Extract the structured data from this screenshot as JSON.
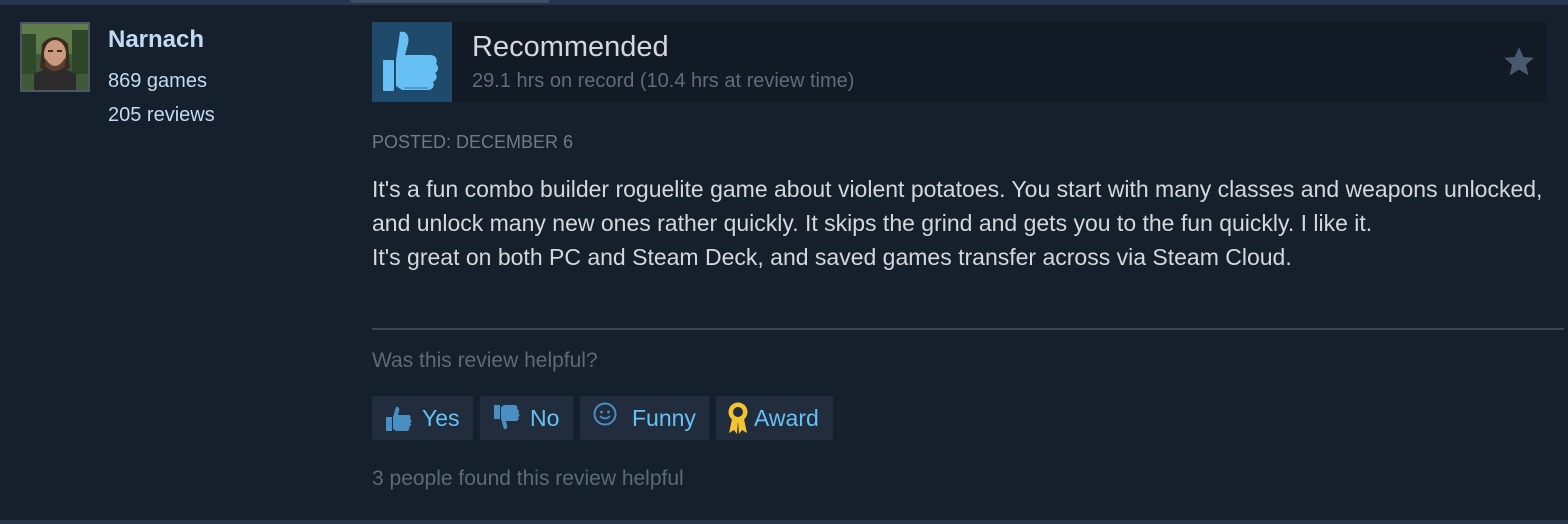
{
  "author": {
    "name": "Narnach",
    "games": "869 games",
    "reviews": "205 reviews"
  },
  "review": {
    "verdict": "Recommended",
    "hours": "29.1 hrs on record (10.4 hrs at review time)",
    "posted": "POSTED: DECEMBER 6",
    "paragraphs": [
      "It's a fun combo builder roguelite game about violent potatoes. You start with many classes and weapons unlocked, and unlock many new ones rather quickly. It skips the grind and gets you to the fun quickly. I like it.",
      "It's great on both PC and Steam Deck, and saved games transfer across via Steam Cloud."
    ]
  },
  "helpful": {
    "question": "Was this review helpful?",
    "buttons": {
      "yes": "Yes",
      "no": "No",
      "funny": "Funny",
      "award": "Award"
    },
    "count_text": "3 people found this review helpful"
  },
  "icons": {
    "verdict": "thumbs-up-icon",
    "star": "star-icon",
    "yes": "thumbs-up-icon",
    "no": "thumbs-down-icon",
    "funny": "smiley-icon",
    "award": "award-ribbon-icon"
  },
  "colors": {
    "background": "#16202d",
    "link_blue": "#67c1f5",
    "name_blue": "#c1dbf4",
    "award_gold": "#f3c430"
  }
}
